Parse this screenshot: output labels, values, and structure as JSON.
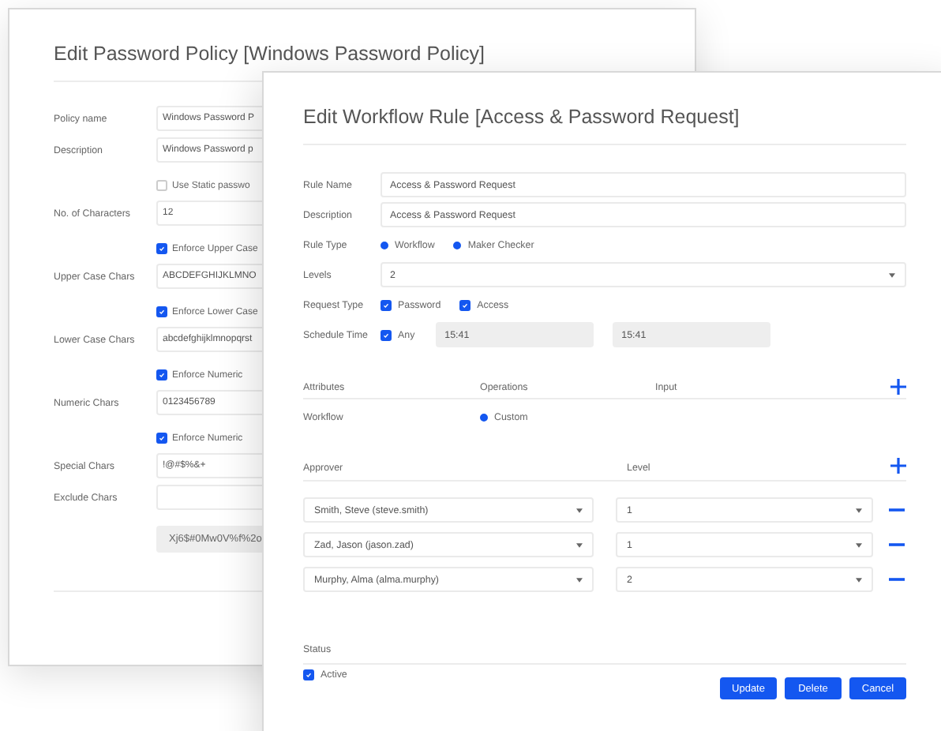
{
  "policy_window": {
    "title": "Edit Password Policy [Windows Password Policy]",
    "rows": [
      {
        "kind": "field",
        "label": "Policy name",
        "value": "Windows Password P"
      },
      {
        "kind": "field",
        "label": "Description",
        "value": "Windows Password p"
      },
      {
        "kind": "check",
        "text": "Use Static passwo",
        "checked": false
      },
      {
        "kind": "field",
        "label": "No. of Characters",
        "value": "12"
      },
      {
        "kind": "check",
        "text": "Enforce Upper Case",
        "checked": true
      },
      {
        "kind": "field",
        "label": "Upper Case Chars",
        "value": "ABCDEFGHIJKLMNO"
      },
      {
        "kind": "check",
        "text": "Enforce Lower Case",
        "checked": true
      },
      {
        "kind": "field",
        "label": "Lower Case Chars",
        "value": "abcdefghijklmnopqrst"
      },
      {
        "kind": "check",
        "text": "Enforce Numeric",
        "checked": true
      },
      {
        "kind": "field",
        "label": "Numeric Chars",
        "value": "0123456789"
      },
      {
        "kind": "check",
        "text": "Enforce Numeric",
        "checked": true
      },
      {
        "kind": "field",
        "label": "Special Chars",
        "value": "!@#$%&+"
      },
      {
        "kind": "field",
        "label": "Exclude Chars"
      },
      {
        "kind": "generated",
        "value": "Xj6$#0Mw0V%f%2o"
      }
    ]
  },
  "rule_window": {
    "title": "Edit Workflow Rule [Access & Password Request]",
    "rule_name": {
      "label": "Rule Name",
      "value": "Access & Password Request"
    },
    "description": {
      "label": "Description",
      "value": "Access & Password Request"
    },
    "rule_type": {
      "label": "Rule Type",
      "options": [
        {
          "label": "Workflow",
          "selected": true
        },
        {
          "label": "Maker Checker",
          "selected": true
        }
      ]
    },
    "levels": {
      "label": "Levels",
      "value": "2"
    },
    "request_type": {
      "label": "Request Type",
      "options": [
        {
          "label": "Password",
          "checked": true
        },
        {
          "label": "Access",
          "checked": true
        }
      ]
    },
    "schedule_time": {
      "label": "Schedule Time",
      "any": {
        "label": "Any",
        "checked": true
      },
      "from": "15:41",
      "to": "15:41"
    },
    "attributes": {
      "columns": [
        "Attributes",
        "Operations",
        "Input"
      ],
      "row": {
        "label": "Workflow",
        "option": {
          "label": "Custom",
          "selected": true
        }
      }
    },
    "approvers": {
      "columns": [
        "Approver",
        "Level"
      ],
      "rows": [
        {
          "approver": "Smith, Steve (steve.smith)",
          "level": "1"
        },
        {
          "approver": "Zad, Jason (jason.zad)",
          "level": "1"
        },
        {
          "approver": "Murphy, Alma (alma.murphy)",
          "level": "2"
        }
      ]
    },
    "status": {
      "label": "Status",
      "active": {
        "label": "Active",
        "checked": true
      }
    },
    "buttons": [
      "Update",
      "Delete",
      "Cancel"
    ]
  }
}
